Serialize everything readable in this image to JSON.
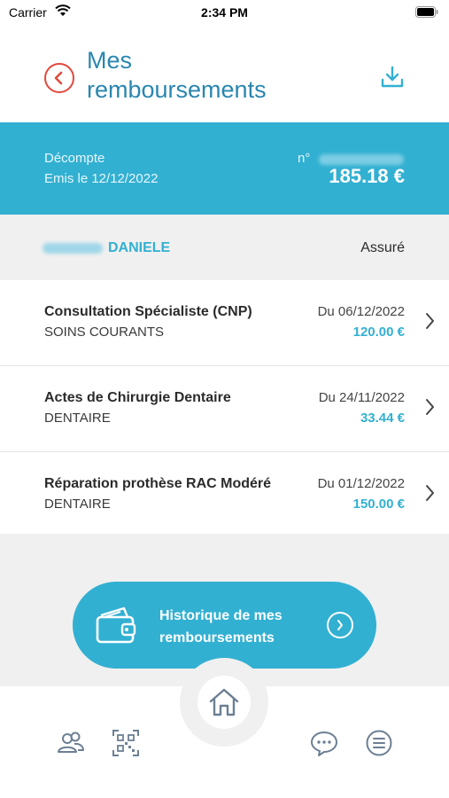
{
  "status_bar": {
    "carrier": "Carrier",
    "time": "2:34 PM"
  },
  "header": {
    "title": "Mes remboursements"
  },
  "decompte": {
    "label": "Décompte",
    "date": "Emis le 12/12/2022",
    "number_label": "n°",
    "total": "185.18 €"
  },
  "insured": {
    "name": "DANIELE",
    "role": "Assuré"
  },
  "claims": [
    {
      "title": "Consultation Spécialiste (CNP)",
      "category": "SOINS COURANTS",
      "date": "Du 06/12/2022",
      "amount": "120.00 €"
    },
    {
      "title": "Actes de Chirurgie Dentaire",
      "category": "DENTAIRE",
      "date": "Du 24/11/2022",
      "amount": "33.44 €"
    },
    {
      "title": "Réparation prothèse RAC Modéré",
      "category": "DENTAIRE",
      "date": "Du 01/12/2022",
      "amount": "150.00 €"
    }
  ],
  "history_button": {
    "label": "Historique de mes remboursements"
  },
  "tab_bar": {
    "items": [
      "users-icon",
      "qr-code-icon",
      "home-icon",
      "chat-icon",
      "menu-icon"
    ]
  },
  "colors": {
    "accent": "#32b0d2",
    "title": "#2a86b0",
    "back": "#e2483b",
    "background_gray": "#f0f0f0"
  }
}
